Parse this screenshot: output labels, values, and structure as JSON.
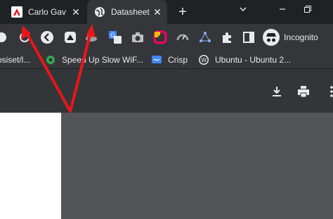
{
  "tabs": [
    {
      "title": "Carlo Gav",
      "favicon": "carlo-logo-icon",
      "active": false
    },
    {
      "title": "Datasheet",
      "favicon": "globe-icon",
      "active": true
    }
  ],
  "new_tab_label": "+",
  "window_controls": {
    "minimize": "chevron-down-icon",
    "restore": "restore-icon"
  },
  "toolbar": {
    "incognito_label": "Incognito",
    "extensions": [
      "circle-icon",
      "left-arrow-icon",
      "extension-icon",
      "cloud-icon",
      "translate-icon",
      "camera-icon",
      "colorful-circle-icon",
      "gauge-icon",
      "network-icon",
      "puzzle-icon",
      "sidebar-icon"
    ]
  },
  "bookmarks": [
    {
      "label": "osiset/l...",
      "icon": "bookmark-partial-icon"
    },
    {
      "label": "Speed Up Slow WiF...",
      "icon": "gear-icon"
    },
    {
      "label": "Crisp",
      "icon": "chat-icon"
    },
    {
      "label": "Ubuntu - Ubuntu 2...",
      "icon": "wordpress-icon"
    }
  ],
  "pdf_toolbar": {
    "download": "download-icon",
    "print": "print-icon",
    "more": "more-vertical-icon"
  },
  "colors": {
    "tabstrip": "#202124",
    "toolbar": "#35363a",
    "pdf_toolbar": "#323639",
    "viewer_bg": "#525659",
    "annotation_arrow": "#e8161b"
  }
}
